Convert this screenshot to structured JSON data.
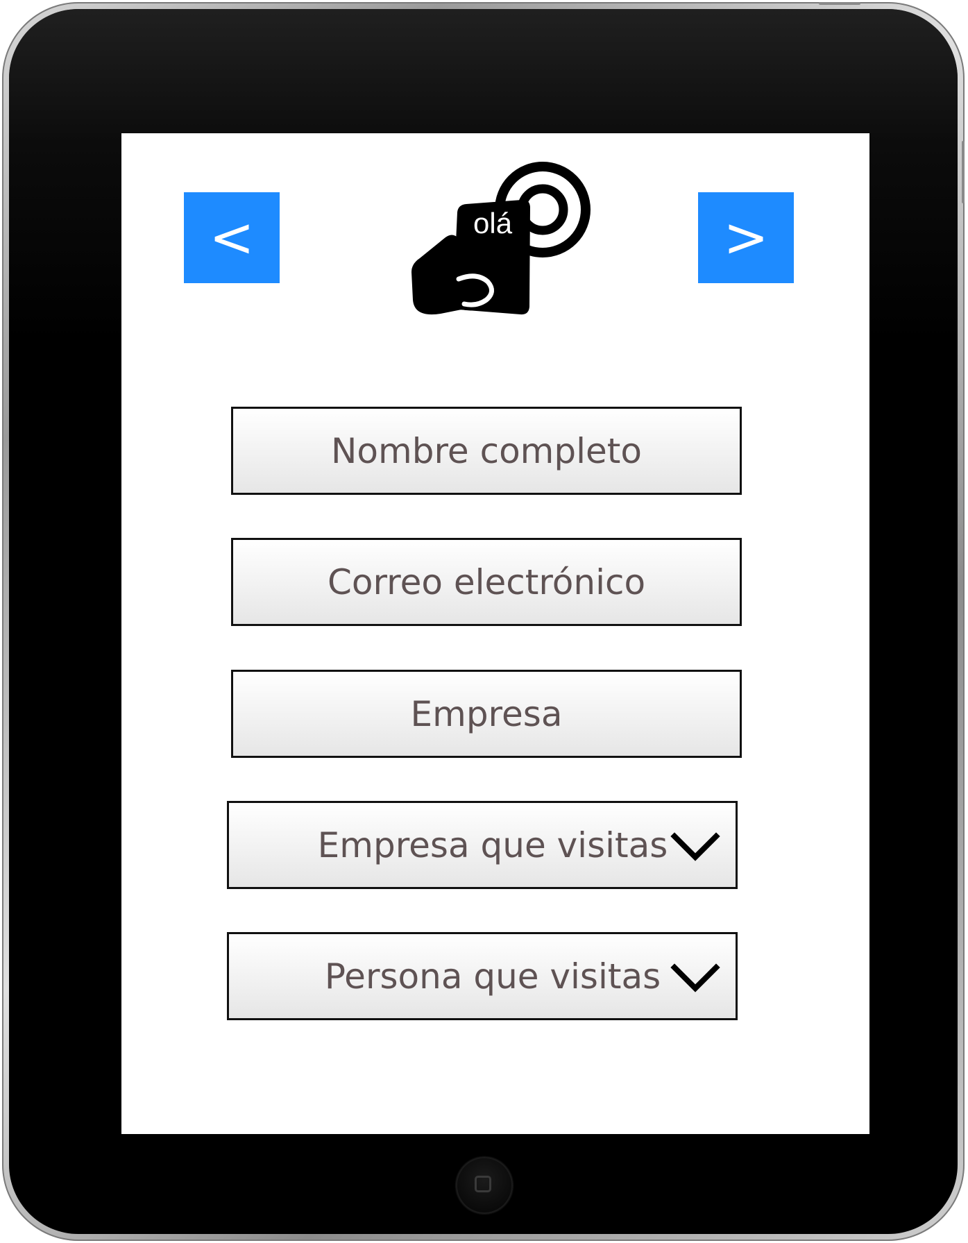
{
  "nav": {
    "prev_label": "<",
    "next_label": ">"
  },
  "logo": {
    "text": "olá",
    "icon": "tap-hand-icon"
  },
  "form": {
    "full_name": "Nombre completo",
    "email": "Correo electrónico",
    "company": "Empresa",
    "visited_company": "Empresa que visitas",
    "visited_person": "Persona que visitas"
  },
  "colors": {
    "accent": "#1e8bff",
    "field_text": "#5e5253",
    "screen_bg": "#ffffff",
    "bezel": "#000000"
  }
}
